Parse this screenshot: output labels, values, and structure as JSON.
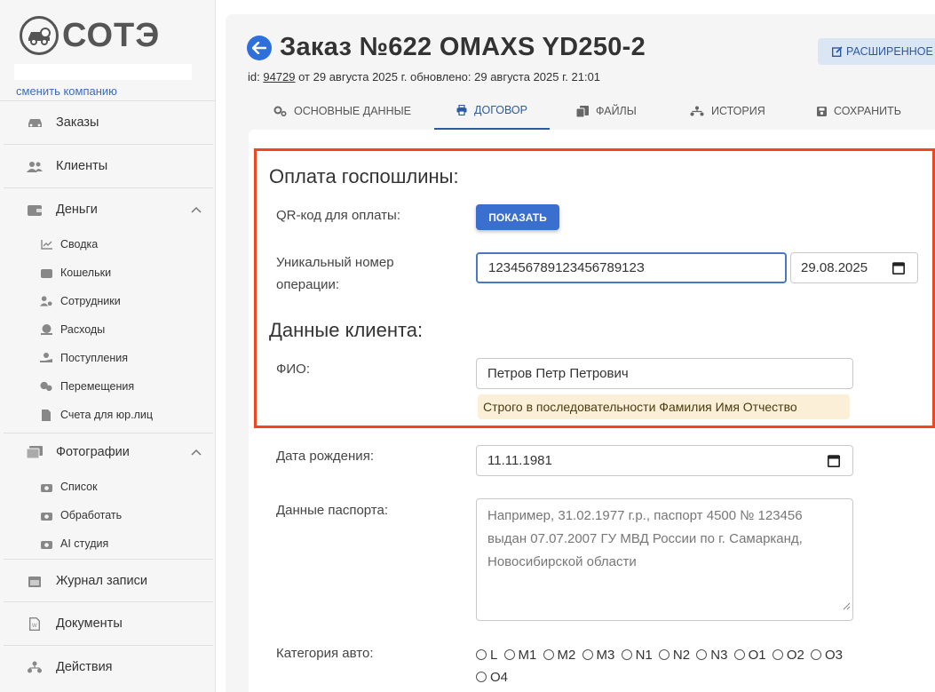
{
  "sidebar": {
    "logo_text": "СОТЭ",
    "switch_company": "сменить компанию",
    "items": [
      {
        "label": "Заказы",
        "icon": "car-icon"
      },
      {
        "label": "Клиенты",
        "icon": "users-icon"
      },
      {
        "label": "Деньги",
        "icon": "wallet-icon"
      },
      {
        "label": "Фотографии",
        "icon": "photos-icon"
      },
      {
        "label": "Журнал записи",
        "icon": "calendar-icon"
      },
      {
        "label": "Документы",
        "icon": "document-icon"
      },
      {
        "label": "Действия",
        "icon": "actions-icon"
      }
    ],
    "money_sub": [
      {
        "label": "Сводка",
        "icon": "chart-icon"
      },
      {
        "label": "Кошельки",
        "icon": "wallet-icon"
      },
      {
        "label": "Сотрудники",
        "icon": "employee-icon"
      },
      {
        "label": "Расходы",
        "icon": "expense-icon"
      },
      {
        "label": "Поступления",
        "icon": "income-icon"
      },
      {
        "label": "Перемещения",
        "icon": "transfer-icon"
      },
      {
        "label": "Счета для юр.лиц",
        "icon": "invoice-icon"
      }
    ],
    "photo_sub": [
      {
        "label": "Список",
        "icon": "camera-icon"
      },
      {
        "label": "Обработать",
        "icon": "camera-process-icon"
      },
      {
        "label": "AI студия",
        "icon": "camera-ai-icon"
      }
    ]
  },
  "header": {
    "title": "Заказ №622 OMAXS YD250-2",
    "meta_prefix": "id: ",
    "meta_id": "94729",
    "meta_suffix": " от 29 августа 2025 г. обновлено: 29 августа 2025 г. 21:01",
    "extended_button": "РАСШИРЕННОЕ Р"
  },
  "tabs": [
    {
      "label": "ОСНОВНЫЕ ДАННЫЕ",
      "icon": "gears-icon"
    },
    {
      "label": "ДОГОВОР",
      "icon": "print-icon",
      "active": true
    },
    {
      "label": "ФАЙЛЫ",
      "icon": "files-icon"
    },
    {
      "label": "ИСТОРИЯ",
      "icon": "history-icon"
    },
    {
      "label": "СОХРАНИТЬ",
      "icon": "save-icon"
    }
  ],
  "form": {
    "fee_heading": "Оплата госпошлины:",
    "qr_label": "QR-код для оплаты:",
    "show_button": "ПОКАЗАТЬ",
    "op_number_label_1": "Уникальный номер",
    "op_number_label_2": "операции:",
    "op_number_value": "12345678912345678912З",
    "op_date_value": "29.08.2025",
    "client_heading": "Данные клиента:",
    "fio_label": "ФИО:",
    "fio_value": "Петров Петр Петрович",
    "fio_hint": "Строго в последовательности Фамилия Имя Отчество",
    "birth_label": "Дата рождения:",
    "birth_value": "11.11.1981",
    "passport_label": "Данные паспорта:",
    "passport_placeholder": "Например, 31.02.1977 г.р., паспорт 4500 № 123456 выдан 07.07.2007 ГУ МВД России по г. Самарканд, Новосибирской области",
    "category_label": "Категория авто:",
    "categories": [
      "L",
      "M1",
      "M2",
      "M3",
      "N1",
      "N2",
      "N3",
      "O1",
      "O2",
      "O3",
      "O4"
    ]
  },
  "colors": {
    "accent": "#2c5aa0",
    "button": "#3a6fd0",
    "highlight": "#f1471d",
    "hint_bg": "#fbf0d7"
  }
}
